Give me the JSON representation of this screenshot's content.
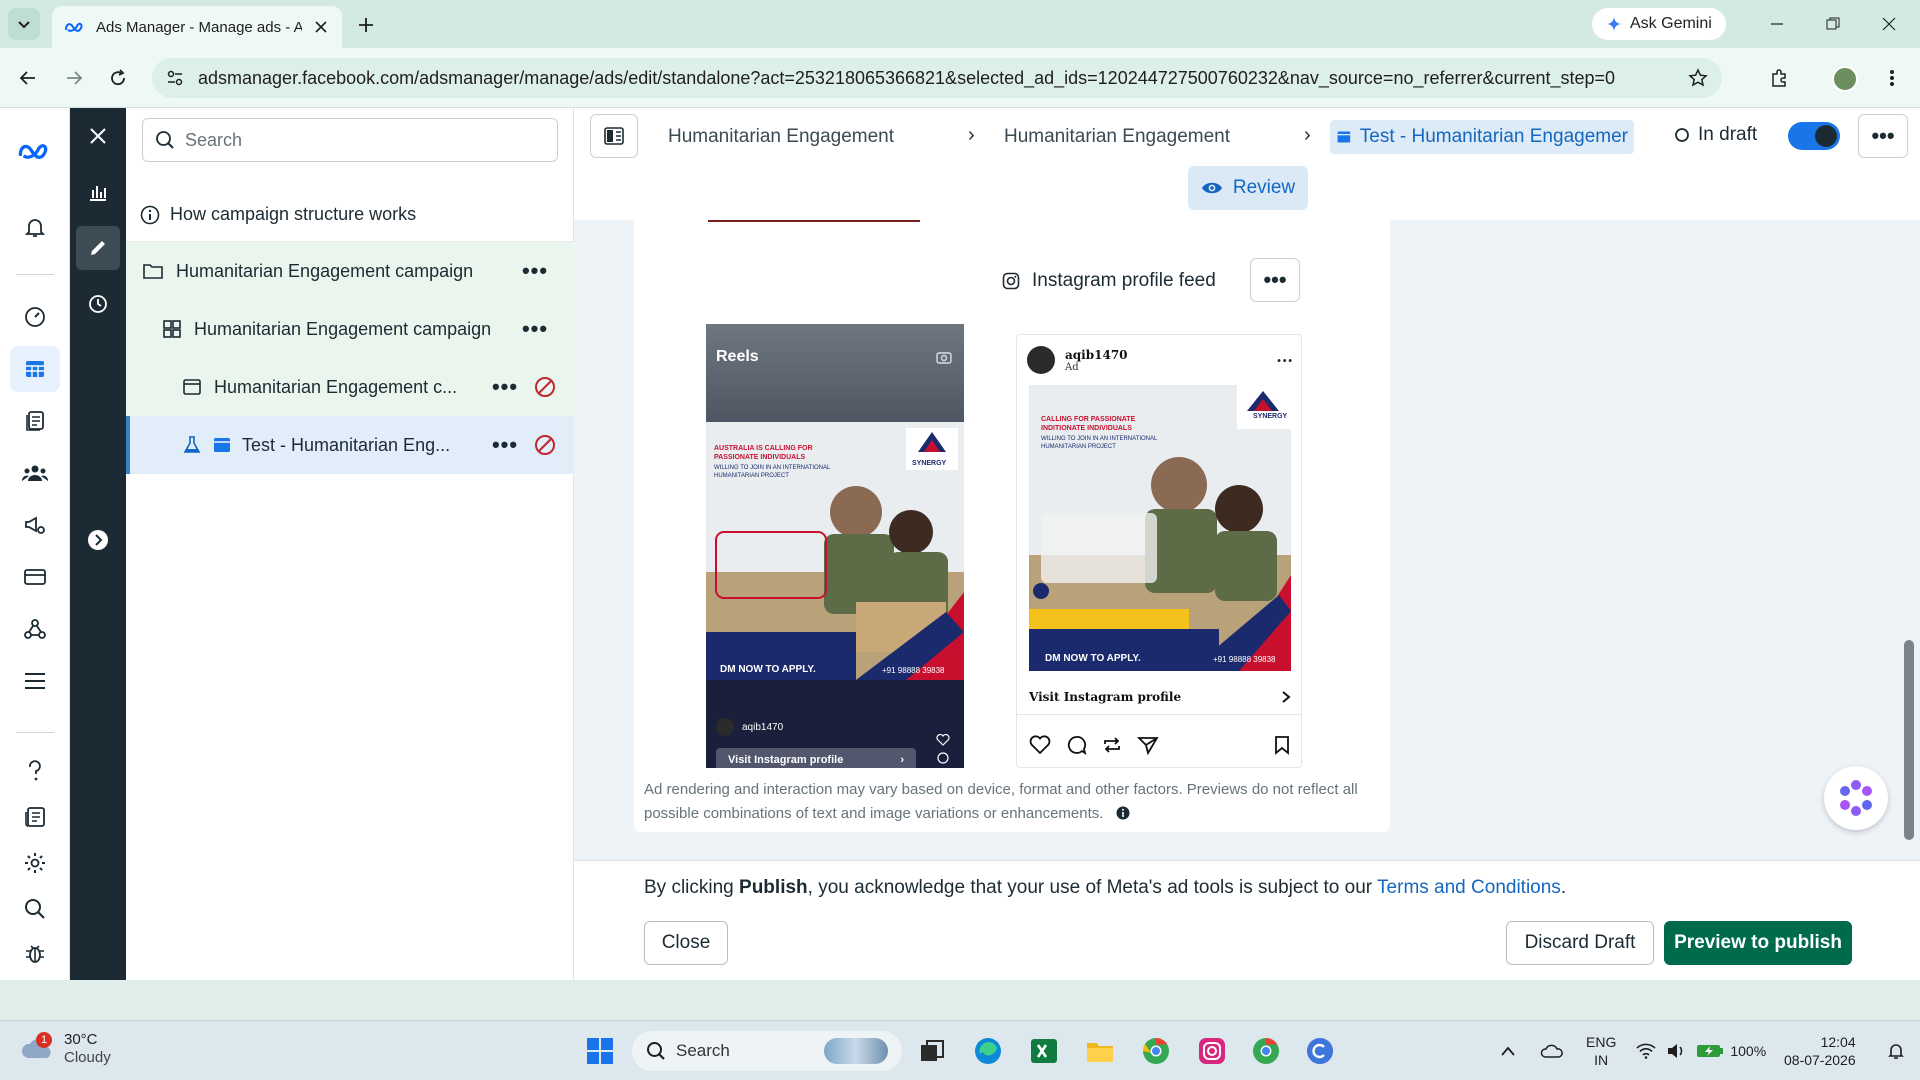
{
  "browser": {
    "tab_title": "Ads Manager - Manage ads - A",
    "ask_gemini": "Ask Gemini",
    "url": "adsmanager.facebook.com/adsmanager/manage/ads/edit/standalone?act=253218065366821&selected_ad_ids=120244727500760232&nav_source=no_referrer&current_step=0"
  },
  "structure": {
    "search_placeholder": "Search",
    "how_link": "How campaign structure works",
    "items": [
      {
        "label": "Humanitarian Engagement campaign"
      },
      {
        "label": "Humanitarian Engagement campaign"
      },
      {
        "label": "Humanitarian Engagement c..."
      },
      {
        "label": "Test - Humanitarian Eng..."
      }
    ]
  },
  "header": {
    "crumb_campaign": "Humanitarian Engagement cam",
    "crumb_adset": "Humanitarian Engagement cam",
    "crumb_ad": "Test - Humanitarian Engagemer",
    "status": "In draft",
    "review": "Review"
  },
  "preview": {
    "placement": "Instagram profile feed",
    "reels_label": "Reels",
    "reels_user": "aqib1470",
    "reels_cta": "Visit Instagram profile",
    "post_user": "aqib1470",
    "post_sub": "Ad",
    "post_cta": "Visit Instagram profile",
    "ad_brand": "SYNERGY",
    "ad_headline_1": "AUSTRALIA IS CALLING FOR PASSIONATE INDIVIDUALS",
    "ad_headline_2": "CALLING FOR PASSIONATE INDITIONATE INDIVIDUALS",
    "ad_sub": "WILLING TO JOIN IN AN INTERNATIONAL HUMANITARIAN PROJECT",
    "ad_dm": "DM NOW TO APPLY.",
    "ad_phone": "+91 98888 39838",
    "disclaimer": "Ad rendering and interaction may vary based on device, format and other factors. Previews do not reflect all possible combinations of text and image variations or enhancements."
  },
  "footer": {
    "legal_prefix": "By clicking ",
    "legal_bold": "Publish",
    "legal_mid": ", you acknowledge that your use of Meta's ad tools is subject to our ",
    "legal_link": "Terms and Conditions",
    "legal_end": ".",
    "close": "Close",
    "discard": "Discard Draft",
    "publish": "Preview to publish"
  },
  "taskbar": {
    "weather_badge": "1",
    "temp": "30°C",
    "condition": "Cloudy",
    "search": "Search",
    "lang_1": "ENG",
    "lang_2": "IN",
    "battery": "100%",
    "time": "12:04",
    "date": "08-07-2026"
  },
  "colors": {
    "publish_green": "#006b4c",
    "link_blue": "#1467c0",
    "toolstrip": "#1c2b33",
    "ban_red": "#c0282d"
  }
}
